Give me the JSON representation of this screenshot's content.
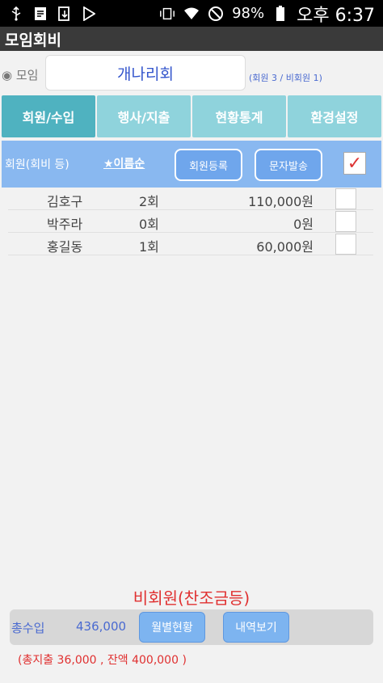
{
  "status_bar": {
    "icons_left": [
      "usb-icon",
      "document-icon",
      "download-icon",
      "play-store-icon"
    ],
    "icons_right": [
      "vibrate-icon",
      "wifi-icon",
      "no-signal-icon"
    ],
    "battery": "98%",
    "time": "오후 6:37"
  },
  "app": {
    "title": "모임회비"
  },
  "group": {
    "label": "◉ 모임",
    "name": "개나리회",
    "counts": "(회원 3 / 비회원 1)"
  },
  "tabs": [
    {
      "label": "회원/수입",
      "active": true
    },
    {
      "label": "행사/지출",
      "active": false
    },
    {
      "label": "현황통계",
      "active": false
    },
    {
      "label": "환경설정",
      "active": false
    }
  ],
  "toolbar": {
    "label": "회원(회비 등)",
    "sort_label": "★이름순",
    "register_label": "회원등록",
    "sms_label": "문자발송",
    "check_mark": "✓"
  },
  "members": [
    {
      "name": "김호구",
      "count": "2회",
      "amount": "110,000원"
    },
    {
      "name": "박주라",
      "count": "0회",
      "amount": "0원"
    },
    {
      "name": "홍길동",
      "count": "1회",
      "amount": "60,000원"
    }
  ],
  "bottom": {
    "nonmember_label": "비회원(찬조금등)",
    "total_income_label": "총수입",
    "total_income_value": "436,000",
    "monthly_button": "월별현황",
    "detail_button": "내역보기",
    "footer": "(총지출  36,000 , 잔액  400,000 )"
  },
  "colors": {
    "tab_active": "#4fb2c0",
    "tab_inactive": "#8fd3dc",
    "toolbar_bg": "#89b8f0",
    "accent_red": "#e03030",
    "accent_blue": "#4a6ad0"
  }
}
